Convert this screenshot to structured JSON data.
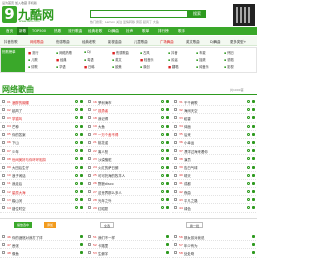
{
  "top": {
    "links": "设为首页 加入收藏 手机版"
  },
  "logo": {
    "mark": "9",
    "name": "九酷网",
    "url": "www.9ku.com"
  },
  "search": {
    "placeholder": "",
    "button": "搜索",
    "hotwords": "热门搜索：Lemon 关注 爱情转移 男孩 起风了 大鱼"
  },
  "nav": {
    "items": [
      "首页",
      "新歌",
      "TOP500",
      "热歌",
      "流行歌曲",
      "经典老歌",
      "DJ舞曲",
      "铃声",
      "歌单",
      "排行榜",
      "歌手"
    ]
  },
  "subnav": {
    "items": [
      "抖音热歌",
      "网络歌曲",
      "伤感歌曲",
      "经典老歌",
      "影视金曲",
      "儿童歌曲",
      "广场舞曲",
      "英文歌曲",
      "DJ舞曲",
      "更多类型+"
    ]
  },
  "filter": {
    "label": "热歌榜单",
    "tags": [
      "流行",
      "网络热歌",
      "DJ",
      "伤感歌曲",
      "古风",
      "抖音",
      "车载",
      "怀旧",
      "儿歌",
      "经典",
      "粤语",
      "英文",
      "轻音乐",
      "民谣",
      "摇滚",
      "说唱",
      "情歌",
      "华语",
      "日韩",
      "欧美",
      "原创",
      "翻唱",
      "纯音乐",
      "影视"
    ]
  },
  "section": {
    "title": "网络歌曲",
    "sub": "共1000首"
  },
  "list1": [
    {
      "n": "01",
      "t": "酒醉的蝴蝶",
      "red": true
    },
    {
      "n": "02",
      "t": "起风了",
      "red": false
    },
    {
      "n": "03",
      "t": "学猫叫",
      "red": true
    },
    {
      "n": "04",
      "t": "芒种",
      "red": false
    },
    {
      "n": "05",
      "t": "你的答案",
      "red": false
    },
    {
      "n": "06",
      "t": "下山",
      "red": false
    },
    {
      "n": "07",
      "t": "少年",
      "red": false
    },
    {
      "n": "08",
      "t": "世间美好与你环环相扣",
      "red": true
    },
    {
      "n": "09",
      "t": "大田后生仔",
      "red": false
    },
    {
      "n": "10",
      "t": "浪子闲话",
      "red": false
    },
    {
      "n": "11",
      "t": "我走后",
      "red": false
    },
    {
      "n": "12",
      "t": "星辰大海",
      "red": true
    },
    {
      "n": "13",
      "t": "踏山河",
      "red": false
    },
    {
      "n": "14",
      "t": "错位时空",
      "red": false
    },
    {
      "n": "15",
      "t": "一路生花",
      "red": false
    }
  ],
  "list2": [
    {
      "n": "16",
      "t": "罗刹海市",
      "red": false
    },
    {
      "n": "17",
      "t": "孤勇者",
      "red": true
    },
    {
      "n": "18",
      "t": "我记得",
      "red": false
    },
    {
      "n": "19",
      "t": "大鱼",
      "red": false
    },
    {
      "n": "20",
      "t": "一万个舍不得",
      "red": true
    },
    {
      "n": "21",
      "t": "桃花诺",
      "red": false
    },
    {
      "n": "22",
      "t": "离人愁",
      "red": false
    },
    {
      "n": "23",
      "t": "沙漠骆驼",
      "red": false
    },
    {
      "n": "24",
      "t": "火红的萨日朗",
      "red": false
    },
    {
      "n": "25",
      "t": "可可托海的牧羊人",
      "red": false
    },
    {
      "n": "26",
      "t": "野狼disco",
      "red": false
    },
    {
      "n": "27",
      "t": "这世界那么多人",
      "red": false
    },
    {
      "n": "28",
      "t": "光年之外",
      "red": false
    },
    {
      "n": "29",
      "t": "红昭愿",
      "red": false
    },
    {
      "n": "30",
      "t": "不谓侠",
      "red": false
    }
  ],
  "list3": [
    {
      "n": "31",
      "t": "千千阙歌",
      "red": false
    },
    {
      "n": "32",
      "t": "海阔天空",
      "red": false
    },
    {
      "n": "33",
      "t": "稻香",
      "red": false
    },
    {
      "n": "34",
      "t": "体面",
      "red": false
    },
    {
      "n": "35",
      "t": "后来",
      "red": false
    },
    {
      "n": "36",
      "t": "小幸运",
      "red": false
    },
    {
      "n": "37",
      "t": "漂洋过海来看你",
      "red": false
    },
    {
      "n": "38",
      "t": "演员",
      "red": false
    },
    {
      "n": "39",
      "t": "告白气球",
      "red": false
    },
    {
      "n": "40",
      "t": "晴天",
      "red": false
    },
    {
      "n": "41",
      "t": "成都",
      "red": false
    },
    {
      "n": "42",
      "t": "夜曲",
      "red": false
    },
    {
      "n": "43",
      "t": "平凡之路",
      "red": false
    },
    {
      "n": "44",
      "t": "绿色",
      "red": false
    },
    {
      "n": "45",
      "t": "消愁",
      "red": false
    }
  ],
  "controls": {
    "play": "播放选中",
    "add": "添加",
    "check": "全选",
    "next": "换一批"
  },
  "list4": [
    {
      "n": "46",
      "t": "你的酒馆对我打了烊"
    },
    {
      "n": "47",
      "t": "嚣张"
    },
    {
      "n": "48",
      "t": "像鱼"
    },
    {
      "n": "49",
      "t": "春娇与志明"
    },
    {
      "n": "50",
      "t": "失恋阵线联盟"
    }
  ],
  "list5": [
    {
      "n": "51",
      "t": "我们不一样"
    },
    {
      "n": "52",
      "t": "卡路里"
    },
    {
      "n": "53",
      "t": "生僻字"
    },
    {
      "n": "54",
      "t": "出山"
    },
    {
      "n": "55",
      "t": "绿色"
    }
  ],
  "list6": [
    {
      "n": "56",
      "t": "那女孩对我说"
    },
    {
      "n": "57",
      "t": "年少有为"
    },
    {
      "n": "58",
      "t": "处处吻"
    },
    {
      "n": "59",
      "t": "来自天堂的魔鬼"
    },
    {
      "n": "60",
      "t": "说散就散"
    }
  ]
}
